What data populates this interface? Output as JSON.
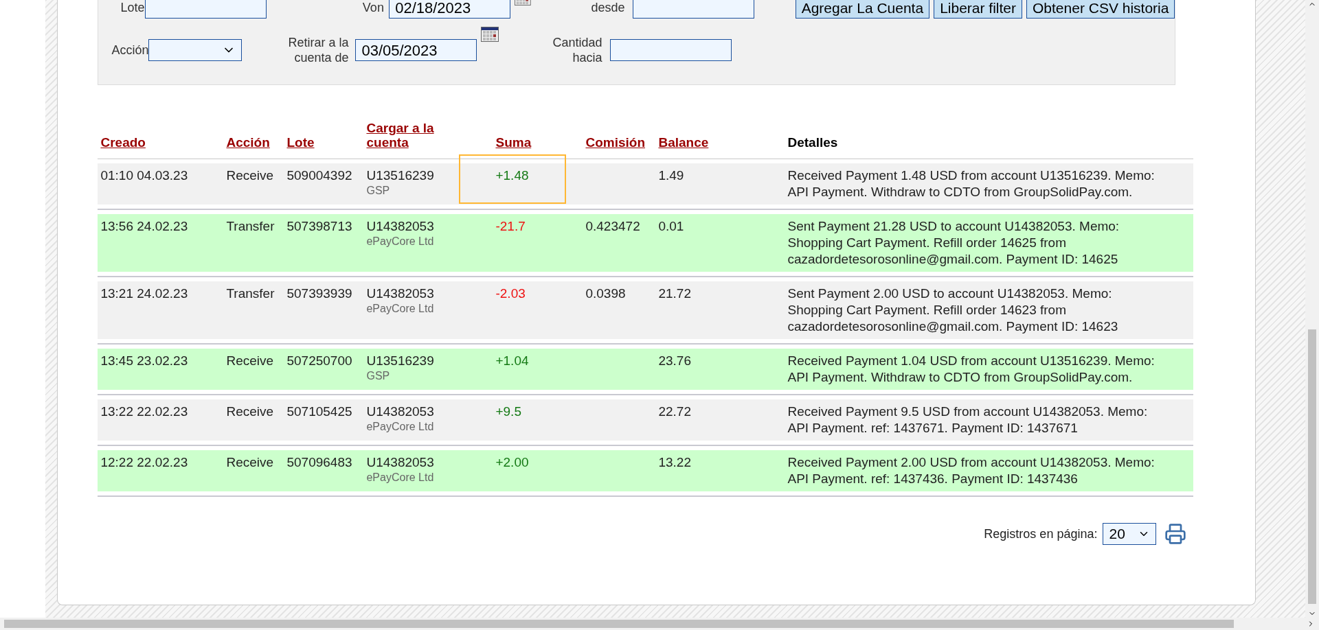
{
  "filters": {
    "lote": {
      "label": "Lote"
    },
    "von": {
      "label": "Von",
      "value": "02/18/2023"
    },
    "cantidad_desde": {
      "label": "desde"
    },
    "accion": {
      "label": "Acción"
    },
    "retirar": {
      "label": "Retirar a la cuenta de",
      "value": "03/05/2023"
    },
    "cantidad_hacia": {
      "label": "Cantidad hacia"
    },
    "buttons": [
      "Agregar La Cuenta",
      "Liberar filter",
      "Obtener CSV historia"
    ]
  },
  "table": {
    "columns": [
      {
        "label": "Creado",
        "link": true
      },
      {
        "label": "Acción",
        "link": true
      },
      {
        "label": "Lote",
        "link": true
      },
      {
        "label": "Cargar a la cuenta",
        "link": true
      },
      {
        "label": "Suma",
        "link": true
      },
      {
        "label": "Comisión",
        "link": true
      },
      {
        "label": "Balance",
        "link": true
      },
      {
        "label": "Detalles",
        "link": false
      }
    ],
    "rows": [
      {
        "color": "#f1f1f1",
        "created": "01:10 04.03.23",
        "action": "Receive",
        "lote": "509004392",
        "account": "U13516239",
        "account_name": "GSP",
        "sum": {
          "text": "+1.48",
          "color": "#157a15",
          "highlighted": true
        },
        "commission": "",
        "balance": "1.49",
        "details": "Received Payment 1.48 USD from account U13516239. Memo: API Payment. Withdraw to CDTO from GroupSolidPay.com."
      },
      {
        "color": "#ccffcc",
        "created": "13:56 24.02.23",
        "action": "Transfer",
        "lote": "507398713",
        "account": "U14382053",
        "account_name": "ePayCore Ltd",
        "sum": {
          "text": "-21.7",
          "color": "#ee1111",
          "highlighted": false
        },
        "commission": "0.423472",
        "balance": "0.01",
        "details": "Sent Payment 21.28 USD to account U14382053. Memo: Shopping Cart Payment. Refill order 14625 from cazadordetesorosonline@gmail.com. Payment ID: 14625"
      },
      {
        "color": "#f1f1f1",
        "created": "13:21 24.02.23",
        "action": "Transfer",
        "lote": "507393939",
        "account": "U14382053",
        "account_name": "ePayCore Ltd",
        "sum": {
          "text": "-2.03",
          "color": "#ee1111",
          "highlighted": false
        },
        "commission": "0.0398",
        "balance": "21.72",
        "details": "Sent Payment 2.00 USD to account U14382053. Memo: Shopping Cart Payment. Refill order 14623 from cazadordetesorosonline@gmail.com. Payment ID: 14623"
      },
      {
        "color": "#ccffcc",
        "created": "13:45 23.02.23",
        "action": "Receive",
        "lote": "507250700",
        "account": "U13516239",
        "account_name": "GSP",
        "sum": {
          "text": "+1.04",
          "color": "#157a15",
          "highlighted": false
        },
        "commission": "",
        "balance": "23.76",
        "details": "Received Payment 1.04 USD from account U13516239. Memo: API Payment. Withdraw to CDTO from GroupSolidPay.com."
      },
      {
        "color": "#f1f1f1",
        "created": "13:22 22.02.23",
        "action": "Receive",
        "lote": "507105425",
        "account": "U14382053",
        "account_name": "ePayCore Ltd",
        "sum": {
          "text": "+9.5",
          "color": "#157a15",
          "highlighted": false
        },
        "commission": "",
        "balance": "22.72",
        "details": "Received Payment 9.5 USD from account U14382053. Memo: API Payment. ref: 1437671. Payment ID: 1437671"
      },
      {
        "color": "#ccffcc",
        "created": "12:22 22.02.23",
        "action": "Receive",
        "lote": "507096483",
        "account": "U14382053",
        "account_name": "ePayCore Ltd",
        "sum": {
          "text": "+2.00",
          "color": "#157a15",
          "highlighted": false
        },
        "commission": "",
        "balance": "13.22",
        "details": "Received Payment 2.00 USD from account U14382053. Memo: API Payment. ref: 1437436. Payment ID: 1437436"
      }
    ]
  },
  "pager": {
    "label": "Registros en página:",
    "value": "20"
  }
}
